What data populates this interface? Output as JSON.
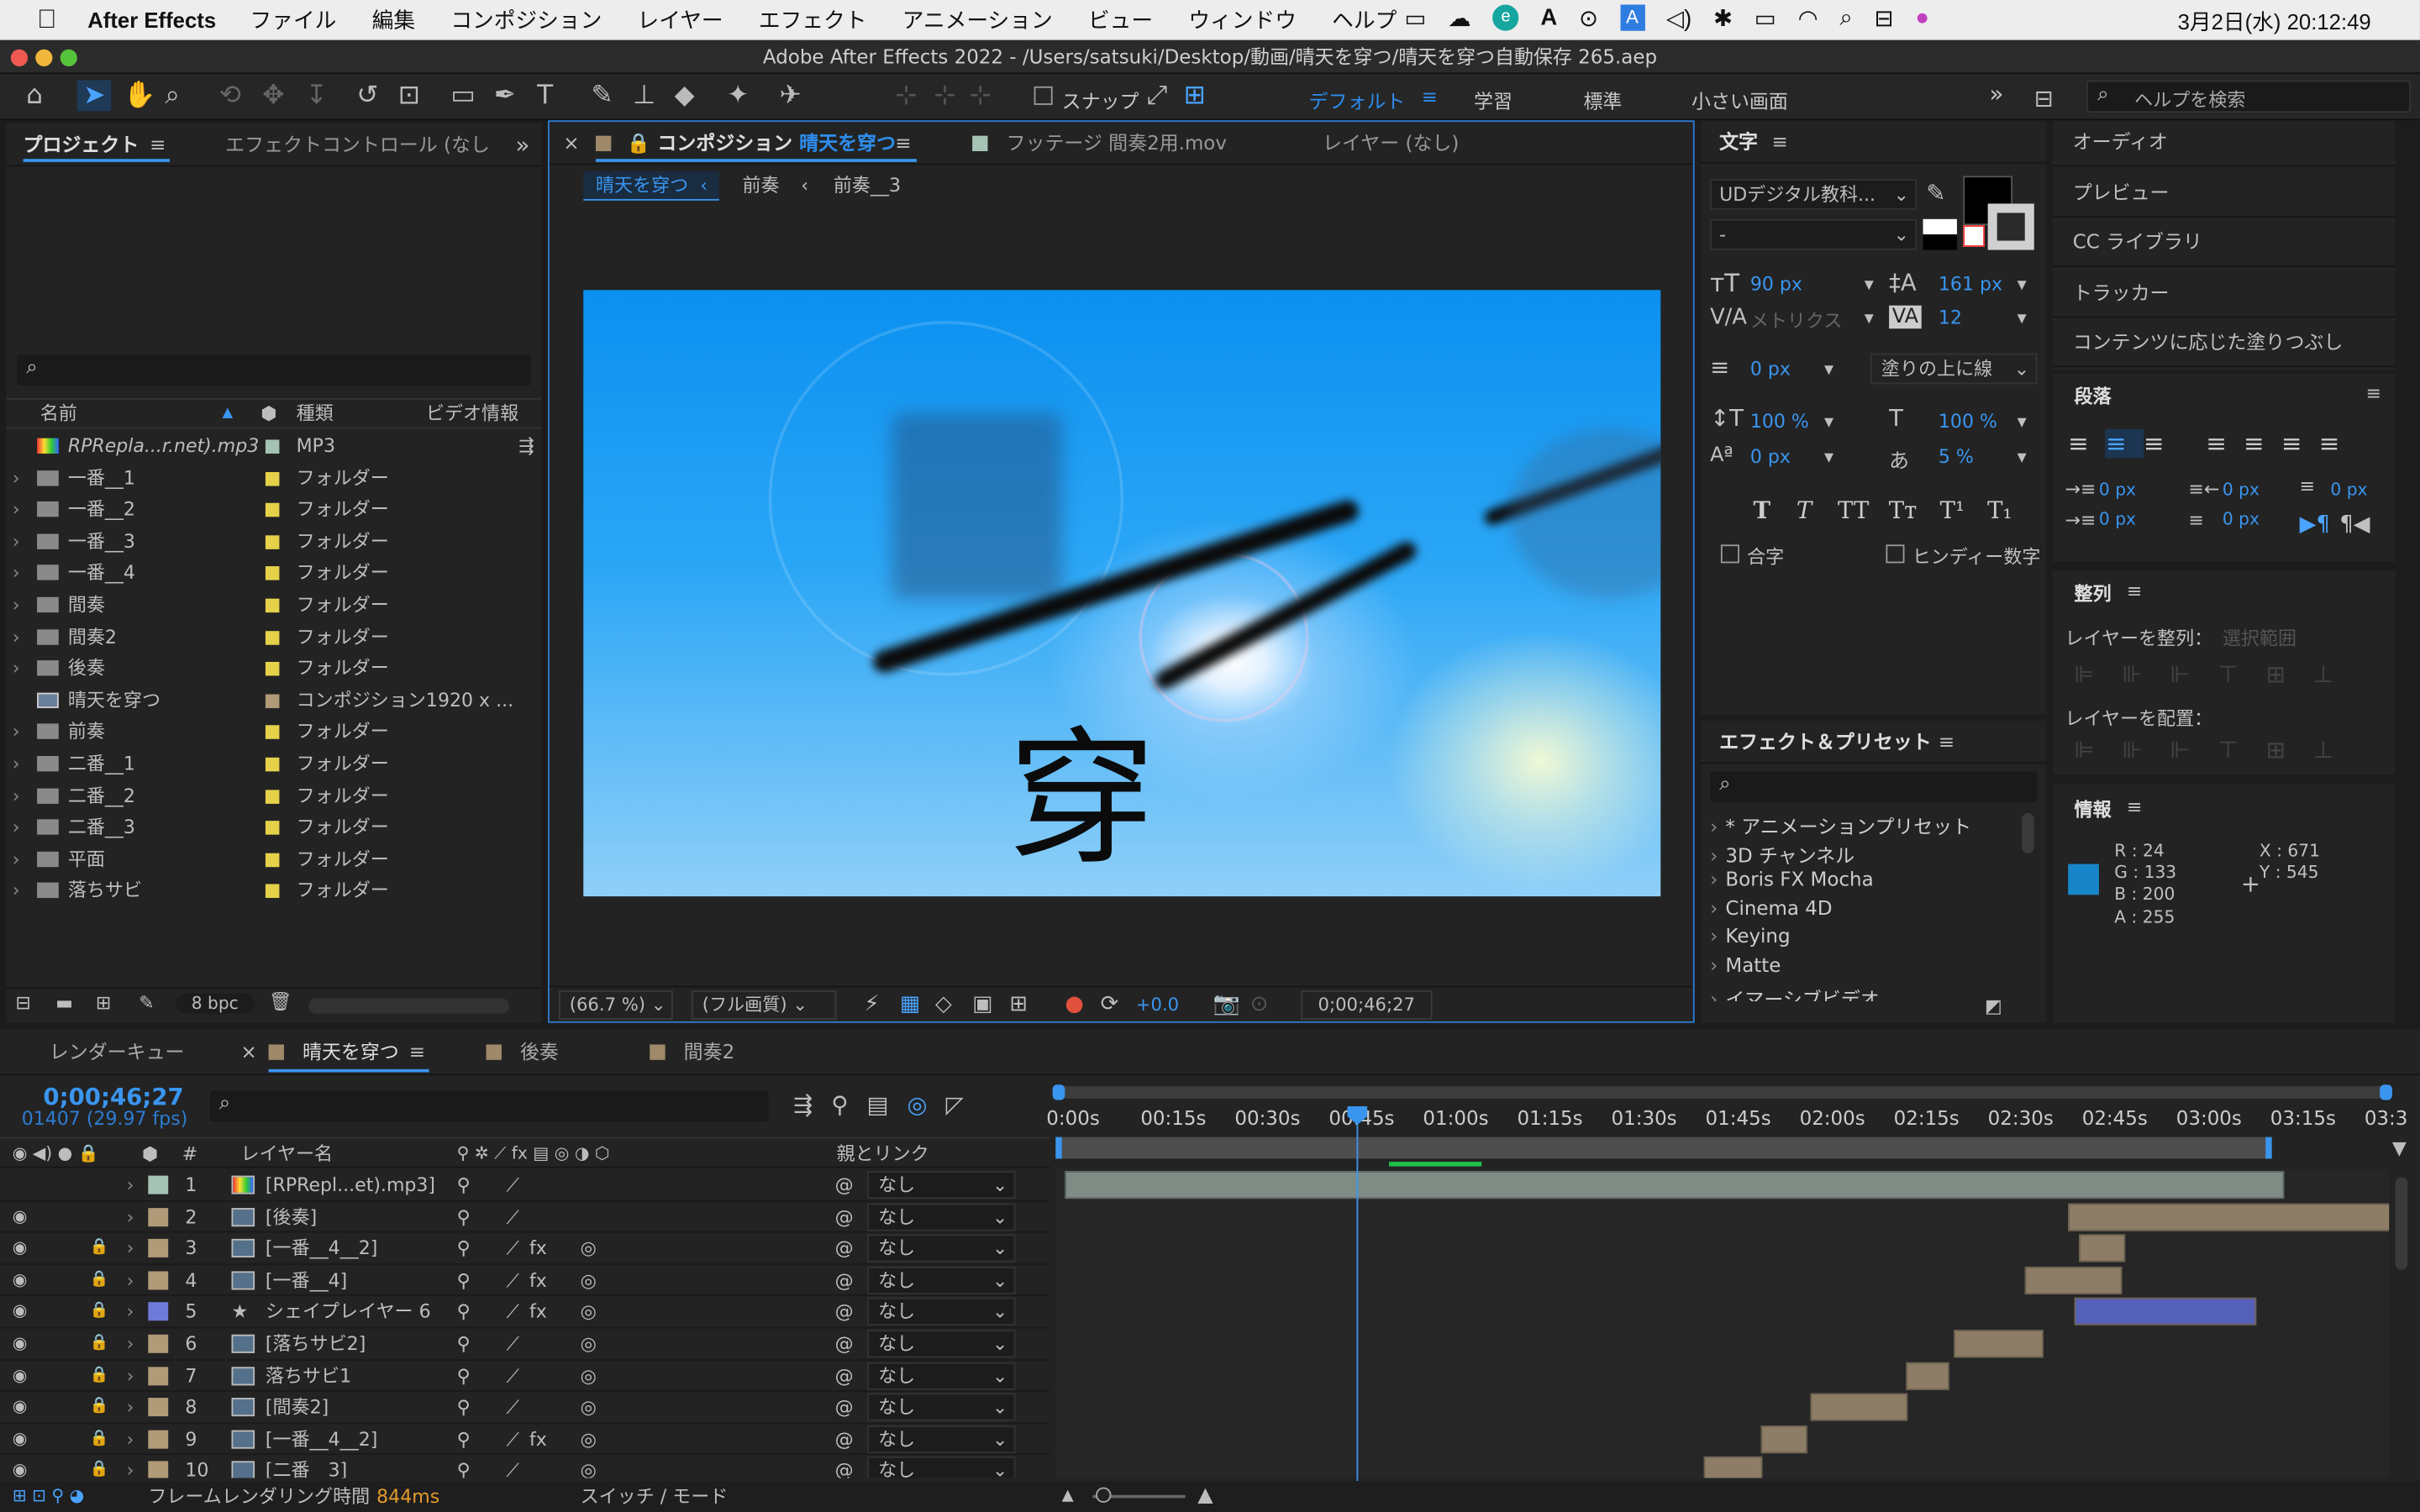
{
  "menubar": {
    "app": "After Effects",
    "items": [
      "ファイル",
      "編集",
      "コンポジション",
      "レイヤー",
      "エフェクト",
      "アニメーション",
      "ビュー",
      "ウィンドウ",
      "ヘルプ"
    ],
    "clock": "3月2日(水)  20:12:49"
  },
  "window": {
    "title": "Adobe After Effects 2022 - /Users/satsuki/Desktop/動画/晴天を穿つ/晴天を穿つ自動保存 265.aep"
  },
  "toolbar": {
    "snap_label": "スナップ",
    "workspaces": [
      "デフォルト",
      "学習",
      "標準",
      "小さい画面"
    ],
    "help_placeholder": "ヘルプを検索"
  },
  "project": {
    "tab": "プロジェクト",
    "tab2": "エフェクトコントロール (なし",
    "cols": [
      "名前",
      "種類",
      "ビデオ情報"
    ],
    "items": [
      {
        "name": "RPRepla...r.net).mp3",
        "type": "MP3",
        "info": "",
        "kind": "audio"
      },
      {
        "name": "一番__1",
        "type": "フォルダー",
        "info": "",
        "kind": "folder"
      },
      {
        "name": "一番__2",
        "type": "フォルダー",
        "info": "",
        "kind": "folder"
      },
      {
        "name": "一番__3",
        "type": "フォルダー",
        "info": "",
        "kind": "folder"
      },
      {
        "name": "一番__4",
        "type": "フォルダー",
        "info": "",
        "kind": "folder"
      },
      {
        "name": "間奏",
        "type": "フォルダー",
        "info": "",
        "kind": "folder"
      },
      {
        "name": "間奏2",
        "type": "フォルダー",
        "info": "",
        "kind": "folder"
      },
      {
        "name": "後奏",
        "type": "フォルダー",
        "info": "",
        "kind": "folder"
      },
      {
        "name": "晴天を穿つ",
        "type": "コンポジション",
        "info": "1920 x ...",
        "kind": "comp"
      },
      {
        "name": "前奏",
        "type": "フォルダー",
        "info": "",
        "kind": "folder"
      },
      {
        "name": "二番__1",
        "type": "フォルダー",
        "info": "",
        "kind": "folder"
      },
      {
        "name": "二番__2",
        "type": "フォルダー",
        "info": "",
        "kind": "folder"
      },
      {
        "name": "二番__3",
        "type": "フォルダー",
        "info": "",
        "kind": "folder"
      },
      {
        "name": "平面",
        "type": "フォルダー",
        "info": "",
        "kind": "folder"
      },
      {
        "name": "落ちサビ",
        "type": "フォルダー",
        "info": "",
        "kind": "folder"
      }
    ],
    "bpc": "8 bpc"
  },
  "comp": {
    "tab_prefix": "コンポジション",
    "tab_name": "晴天を穿つ",
    "footage_tab": "フッテージ 間奏2用.mov",
    "layer_tab": "レイヤー (なし)",
    "breadcrumbs": [
      "晴天を穿つ",
      "前奏",
      "前奏__3"
    ],
    "glyph": "穿",
    "zoom": "(66.7 %)",
    "quality": "(フル画質)",
    "exposure": "+0.0",
    "timecode": "0;00;46;27"
  },
  "character": {
    "title": "文字",
    "font": "UDデジタル教科...",
    "style": "-",
    "size": "90 px",
    "leading": "161 px",
    "kerning": "メトリクス",
    "tracking": "12",
    "stroke": "0 px",
    "stroke_mode": "塗りの上に線",
    "vscale": "100 %",
    "hscale": "100 %",
    "baseline": "0 px",
    "tsume": "5 %",
    "ligature": "合字",
    "hindi": "ヒンディー数字",
    "styles": [
      "T",
      "T",
      "TT",
      "Tт",
      "T¹",
      "T₁"
    ]
  },
  "right_panels": [
    "オーディオ",
    "プレビュー",
    "CC ライブラリ",
    "トラッカー",
    "コンテンツに応じた塗りつぶし"
  ],
  "paragraph": {
    "title": "段落",
    "values": [
      "0 px",
      "0 px",
      "0 px",
      "0 px",
      "0 px"
    ]
  },
  "align": {
    "title": "整列",
    "align_to": "レイヤーを整列：",
    "align_to_value": "選択範囲",
    "distribute": "レイヤーを配置："
  },
  "info": {
    "title": "情報",
    "r": "R :  24",
    "g": "G :  133",
    "b": "B :  200",
    "a": "A :  255",
    "x": "X :  671",
    "y": "Y :  545",
    "color": "#1885c8"
  },
  "effects": {
    "title": "エフェクト＆プリセット",
    "items": [
      "* アニメーションプリセット",
      "3D チャンネル",
      "Boris FX Mocha",
      "Cinema 4D",
      "Keying",
      "Matte",
      "イマーシブビデオ"
    ]
  },
  "timeline": {
    "tabs": [
      "レンダーキュー",
      "晴天を穿つ",
      "後奏",
      "間奏2"
    ],
    "timecode": "0;00;46;27",
    "frames": "01407 (29.97 fps)",
    "col_name": "レイヤー名",
    "col_parent": "親とリンク",
    "ruler": [
      "0:00s",
      "00:15s",
      "00:30s",
      "00:45s",
      "01:00s",
      "01:15s",
      "01:30s",
      "01:45s",
      "02:00s",
      "02:15s",
      "02:30s",
      "02:45s",
      "03:00s",
      "03:15s",
      "03:3"
    ],
    "layers": [
      {
        "num": "1",
        "name": "[RPRepl...et).mp3]",
        "parent": "なし",
        "color": "#a5c3b4"
      },
      {
        "num": "2",
        "name": "[後奏]",
        "parent": "なし",
        "color": "#b19a78"
      },
      {
        "num": "3",
        "name": "[一番__4__2]",
        "parent": "なし",
        "color": "#b19a78"
      },
      {
        "num": "4",
        "name": "[一番__4]",
        "parent": "なし",
        "color": "#b19a78"
      },
      {
        "num": "5",
        "name": "シェイプレイヤー 6",
        "parent": "なし",
        "color": "#6f79d8"
      },
      {
        "num": "6",
        "name": "[落ちサビ2]",
        "parent": "なし",
        "color": "#b19a78"
      },
      {
        "num": "7",
        "name": "落ちサビ1",
        "parent": "なし",
        "color": "#b19a78"
      },
      {
        "num": "8",
        "name": "[間奏2]",
        "parent": "なし",
        "color": "#b19a78"
      },
      {
        "num": "9",
        "name": "[一番__4__2]",
        "parent": "なし",
        "color": "#b19a78"
      },
      {
        "num": "10",
        "name": "[二番__3]",
        "parent": "なし",
        "color": "#b19a78"
      }
    ],
    "render_time_label": "フレームレンダリング時間",
    "render_time": "844ms",
    "switch_mode": "スイッチ / モード"
  }
}
